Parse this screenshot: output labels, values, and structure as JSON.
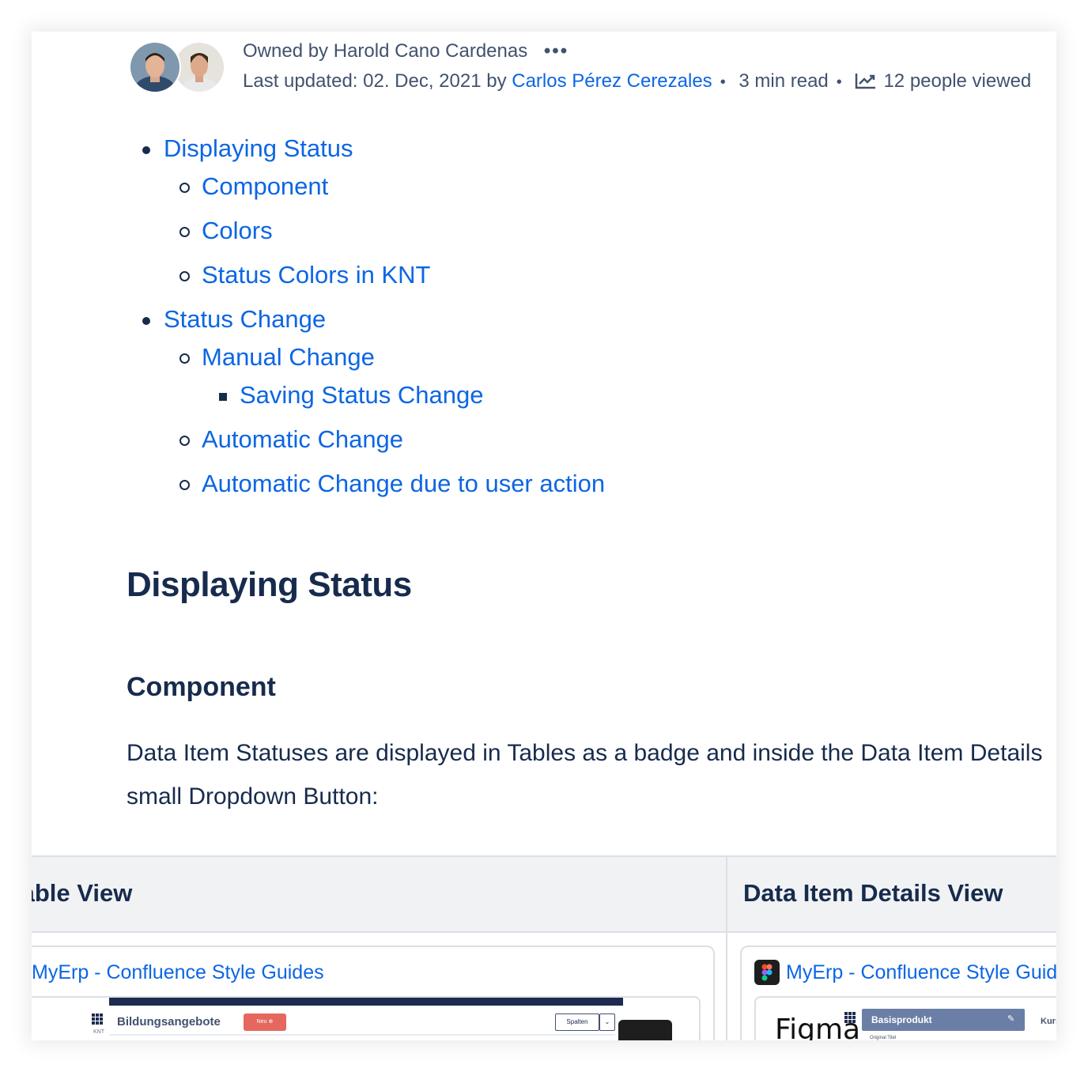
{
  "byline": {
    "owned_prefix": "Owned by",
    "owner": "Harold Cano Cardenas",
    "more": "•••",
    "updated_prefix": "Last updated: 02. Dec, 2021 by",
    "updated_by": "Carlos Pérez Cerezales",
    "read_time": "3 min read",
    "views": "12 people viewed"
  },
  "toc": [
    {
      "level": 1,
      "label": "Displaying Status"
    },
    {
      "level": 2,
      "label": "Component"
    },
    {
      "level": 2,
      "label": "Colors"
    },
    {
      "level": 2,
      "label": "Status Colors in KNT"
    },
    {
      "level": 1,
      "label": "Status Change"
    },
    {
      "level": 2,
      "label": "Manual Change"
    },
    {
      "level": 3,
      "label": "Saving Status Change"
    },
    {
      "level": 2,
      "label": "Automatic Change"
    },
    {
      "level": 2,
      "label": "Automatic Change due to user action"
    }
  ],
  "headings": {
    "displaying_status": "Displaying Status",
    "component": "Component"
  },
  "paragraph": {
    "line1": "Data Item Statuses are displayed in Tables as a badge and inside the Data Item Details",
    "line2": "small Dropdown Button:"
  },
  "table": {
    "col1_header": "Table View",
    "col2_header": "Data Item Details View",
    "col1_card_title": "MyErp - Confluence Style Guides",
    "col2_card_title": "MyErp - Confluence Style Guides",
    "col1_preview": {
      "module": "KNT",
      "title": "Bildungsangebote",
      "new_button": "Neu ⊕",
      "columns_button": "Spalten",
      "dropdown": "⌄"
    },
    "col2_preview": {
      "figma": "Figma",
      "panel_title": "Basisprodukt",
      "panel_sub": "Original Titel",
      "edit": "✎",
      "side_label": "Kurs"
    }
  },
  "colors": {
    "link": "#0c66e4",
    "text": "#172b4d",
    "muted": "#42526e",
    "header_bg": "#f1f2f4",
    "border": "#dcdfe4"
  },
  "icons": [
    "more-icon",
    "trend-icon",
    "figma-icon",
    "grid-icon"
  ]
}
